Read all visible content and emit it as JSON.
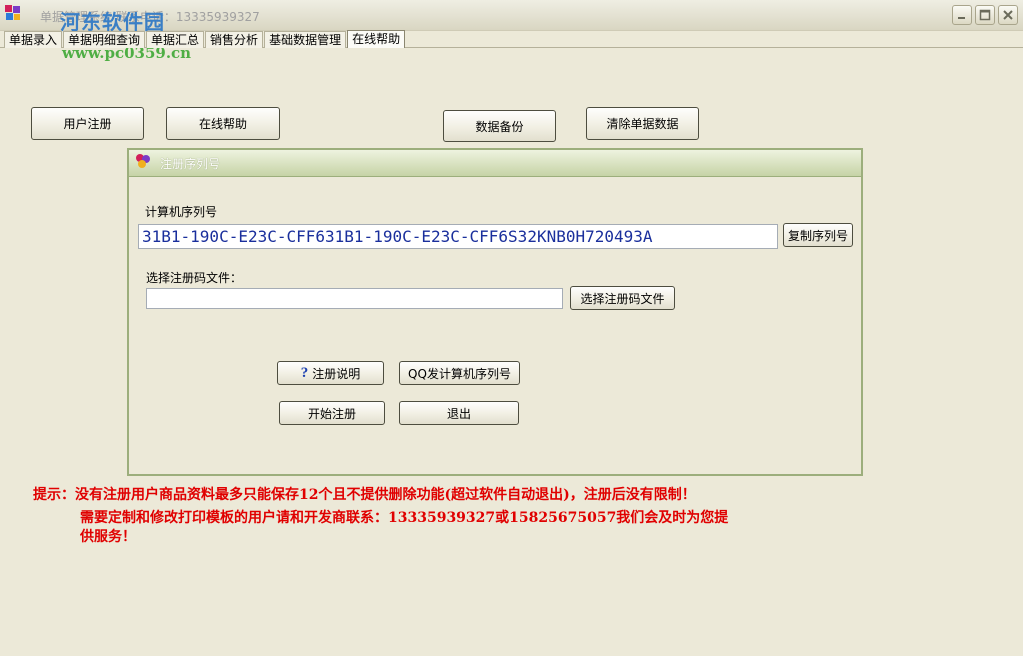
{
  "window": {
    "title": "单据管理系统 联系电话：13335939327",
    "watermark": "河东软件园",
    "watermark_url": "www.pc0359.cn"
  },
  "tabs": [
    {
      "label": "单据录入",
      "active": false
    },
    {
      "label": "单据明细查询",
      "active": false
    },
    {
      "label": "单据汇总",
      "active": false
    },
    {
      "label": "销售分析",
      "active": false
    },
    {
      "label": "基础数据管理",
      "active": false
    },
    {
      "label": "在线帮助",
      "active": true
    }
  ],
  "toolbar": {
    "register_label": "用户注册",
    "online_help_label": "在线帮助",
    "backup_label": "数据备份",
    "clear_label": "清除单据数据"
  },
  "dialog": {
    "title": "注册序列号",
    "machine_serial_label": "计算机序列号",
    "machine_serial_value": "31B1-190C-E23C-CFF631B1-190C-E23C-CFF6S32KNB0H720493A",
    "copy_serial_label": "复制序列号",
    "reg_file_label": "选择注册码文件：",
    "reg_file_value": "",
    "choose_file_label": "选择注册码文件",
    "reg_help_label": "注册说明",
    "qq_send_label": "QQ发计算机序列号",
    "start_register_label": "开始注册",
    "exit_label": "退出"
  },
  "notice": {
    "line1": "提示：没有注册用户商品资料最多只能保存12个且不提供删除功能(超过软件自动退出)，注册后没有限制！",
    "line2": "需要定制和修改打印模板的用户请和开发商联系：13335939327或15825675057我们会及时为您提",
    "line3": "供服务！",
    "color": "#e00000"
  },
  "icons": {
    "minimize": "minimize-icon",
    "maximize": "maximize-icon",
    "close": "close-icon",
    "help": "question-icon"
  }
}
